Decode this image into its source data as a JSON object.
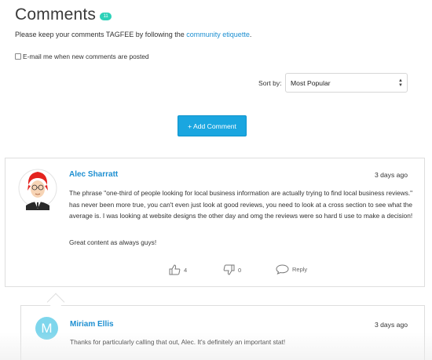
{
  "header": {
    "title": "Comments",
    "count": "11"
  },
  "intro": {
    "text_before": "Please keep your comments TAGFEE by following the ",
    "link": "community etiquette",
    "text_after": "."
  },
  "email_option": {
    "label": "E-mail me when new comments are posted",
    "checked": false
  },
  "sort": {
    "label": "Sort by:",
    "selected": "Most Popular"
  },
  "add_button": {
    "label": "+ Add Comment"
  },
  "comments": [
    {
      "author": "Alec Sharratt",
      "time": "3 days ago",
      "body": "The phrase \"one-third of people looking for local business information are actually trying to find local business reviews.\" has never been more true, you can't even just look at good reviews, you need to look at a cross section to see what the average is. I was looking at website designs the other day and omg the reviews were so hard ti use to make a decision!",
      "body2": "Great content as always guys!",
      "likes": "4",
      "dislikes": "0",
      "reply_label": "Reply",
      "avatar_icon": "cartoon-avatar-icon"
    }
  ],
  "reply": {
    "initial": "M",
    "author": "Miriam Ellis",
    "time": "3 days ago",
    "body": "Thanks for particularly calling that out, Alec. It's definitely an important stat!"
  },
  "colors": {
    "link": "#1d8fd1",
    "badge": "#2bd1b8",
    "button": "#1aa6e0",
    "avatar_m": "#7ed6ec",
    "border": "#dedede"
  }
}
